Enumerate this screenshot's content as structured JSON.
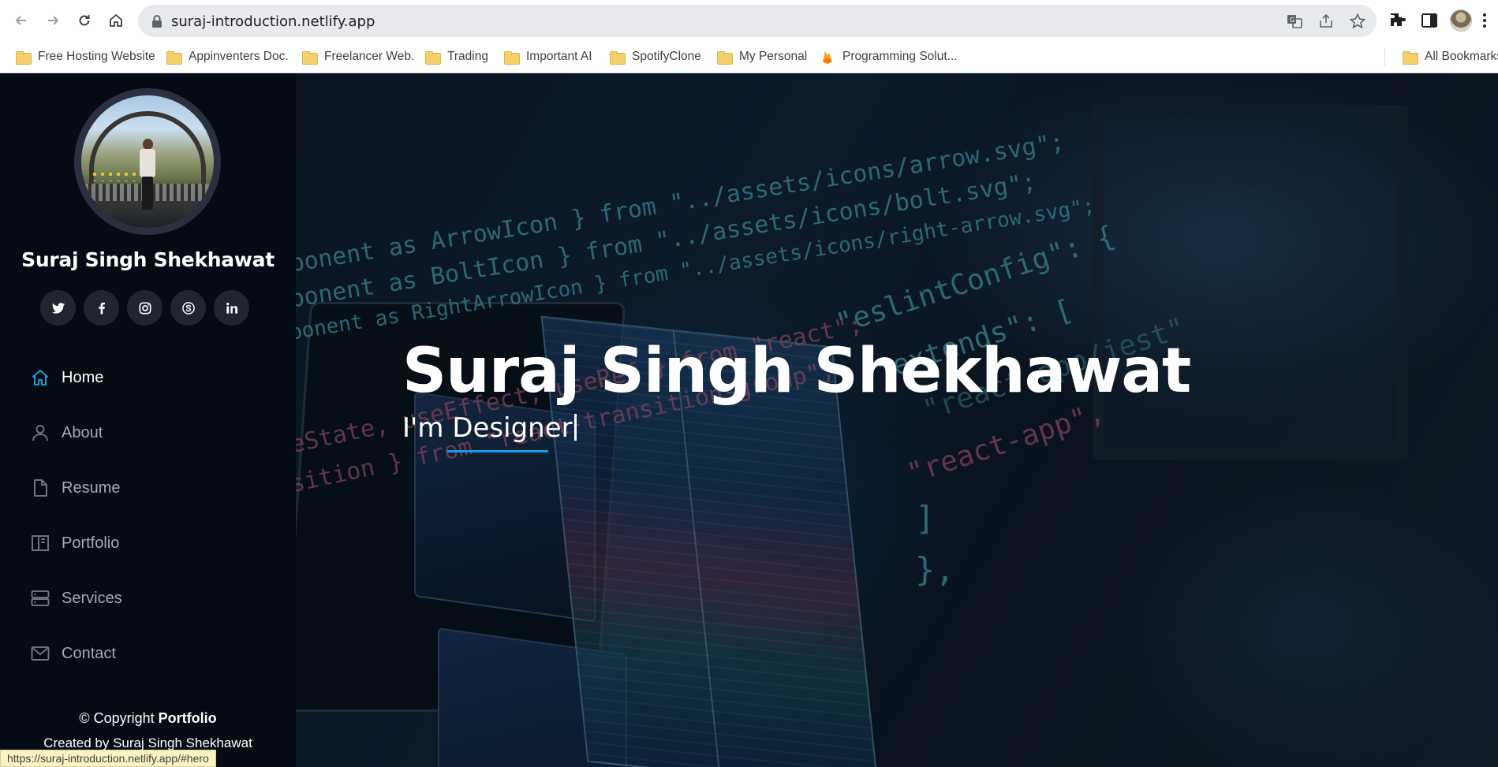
{
  "browser": {
    "url": "suraj-introduction.netlify.app",
    "status_url": "https://suraj-introduction.netlify.app/#hero",
    "bookmarks": [
      {
        "label": "Free Hosting Website",
        "icon": "folder-icon"
      },
      {
        "label": "Appinventers Doc.",
        "icon": "folder-icon"
      },
      {
        "label": "Freelancer Web.",
        "icon": "folder-icon"
      },
      {
        "label": "Trading",
        "icon": "folder-icon"
      },
      {
        "label": "Important AI",
        "icon": "folder-icon"
      },
      {
        "label": "SpotifyClone",
        "icon": "folder-icon"
      },
      {
        "label": "My Personal",
        "icon": "folder-icon"
      },
      {
        "label": "Programming Solut...",
        "icon": "firebase-icon"
      }
    ],
    "all_bookmarks": "All Bookmarks"
  },
  "sidebar": {
    "name": "Suraj Singh Shekhawat",
    "social": [
      {
        "name": "twitter",
        "icon": "twitter-icon"
      },
      {
        "name": "facebook",
        "icon": "facebook-icon"
      },
      {
        "name": "instagram",
        "icon": "instagram-icon"
      },
      {
        "name": "skype",
        "icon": "skype-icon"
      },
      {
        "name": "linkedin",
        "icon": "linkedin-icon"
      }
    ],
    "menu": [
      {
        "label": "Home",
        "icon": "home-icon",
        "active": true
      },
      {
        "label": "About",
        "icon": "person-icon",
        "active": false
      },
      {
        "label": "Resume",
        "icon": "file-icon",
        "active": false
      },
      {
        "label": "Portfolio",
        "icon": "portfolio-icon",
        "active": false
      },
      {
        "label": "Services",
        "icon": "server-icon",
        "active": false
      },
      {
        "label": "Contact",
        "icon": "envelope-icon",
        "active": false
      }
    ],
    "copyright_prefix": "© Copyright",
    "copyright_brand": "Portfolio",
    "credits": "Created by Suraj Singh Shekhawat"
  },
  "hero": {
    "title": "Suraj Singh Shekhawat",
    "typed_prefix": "I'm",
    "typed_word": "Designer",
    "accent_color": "#149ddd",
    "code_lines": [
      "ponent as ArrowIcon } from \"../assets/icons/arrow.svg\";",
      "ponent as BoltIcon } from \"../assets/icons/bolt.svg\";",
      "ponent as RightArrowIcon } from \"../assets/icons/right-arrow.svg\";",
      "mponent as RightArrowIcon } from \"react\";",
      "eState, useEffect, useRef } from \"react\";",
      "sition } from \"react-transition-group\";",
      "\"eslintConfig\": {",
      "\"extends\": [",
      "\"react-app\",",
      "\"react-app/jest\"",
      "]",
      "},"
    ]
  }
}
